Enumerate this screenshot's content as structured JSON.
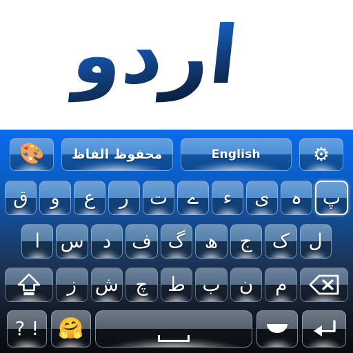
{
  "app": {
    "banner_word": "اردو",
    "background_top_color": "#ffffff",
    "accent_color": "#0a6ae8",
    "keyboard_top_color": "#0a6ae8",
    "keyboard_bottom_color": "#070a0f"
  },
  "toolbar": {
    "theme_button": {
      "label": "",
      "icon": "palette-icon",
      "glyph": "🎨"
    },
    "saved_words_button": {
      "label": "محفوظ الفاظ"
    },
    "language_button": {
      "label": "English"
    },
    "settings_button": {
      "label": "",
      "icon": "gear-icon",
      "glyph": "⚙"
    }
  },
  "keyboard": {
    "rows": [
      {
        "name": "row-1",
        "keys": [
          {
            "label": "ق",
            "name": "key-qaf"
          },
          {
            "label": "و",
            "name": "key-waw"
          },
          {
            "label": "ع",
            "name": "key-ain"
          },
          {
            "label": "ر",
            "name": "key-re"
          },
          {
            "label": "ت",
            "name": "key-te"
          },
          {
            "label": "ے",
            "name": "key-bari-ye"
          },
          {
            "label": "ء",
            "name": "key-hamza"
          },
          {
            "label": "ی",
            "name": "key-ye"
          },
          {
            "label": "ہ",
            "name": "key-gol-he"
          },
          {
            "label": "پ",
            "name": "key-pe",
            "active": true
          }
        ]
      },
      {
        "name": "row-2",
        "keys": [
          {
            "label": "ا",
            "name": "key-alif"
          },
          {
            "label": "س",
            "name": "key-seen"
          },
          {
            "label": "د",
            "name": "key-dal"
          },
          {
            "label": "ف",
            "name": "key-fe"
          },
          {
            "label": "گ",
            "name": "key-gaf"
          },
          {
            "label": "ھ",
            "name": "key-do-chashmi-he"
          },
          {
            "label": "ج",
            "name": "key-jeem"
          },
          {
            "label": "ک",
            "name": "key-kaf"
          },
          {
            "label": "ل",
            "name": "key-lam"
          }
        ]
      },
      {
        "name": "row-3",
        "keys": [
          {
            "label": "",
            "name": "shift-key",
            "icon": "shift-arrow-icon"
          },
          {
            "label": "ز",
            "name": "key-ze"
          },
          {
            "label": "ش",
            "name": "key-sheen"
          },
          {
            "label": "چ",
            "name": "key-che"
          },
          {
            "label": "ط",
            "name": "key-toe"
          },
          {
            "label": "ب",
            "name": "key-be"
          },
          {
            "label": "ن",
            "name": "key-noon"
          },
          {
            "label": "م",
            "name": "key-meem"
          },
          {
            "label": "",
            "name": "backspace-key",
            "icon": "backspace-icon"
          }
        ]
      },
      {
        "name": "row-4",
        "keys": [
          {
            "label": "! ?",
            "name": "symbols-key"
          },
          {
            "label": "",
            "name": "emoji-key",
            "icon": "hugging-face-emoji",
            "glyph": "🤗"
          },
          {
            "label": "",
            "name": "space-key",
            "icon": "space-bar-icon"
          },
          {
            "label": "",
            "name": "diacritic-key",
            "icon": "crescent-icon"
          },
          {
            "label": "",
            "name": "enter-key",
            "icon": "return-arrow-icon"
          }
        ]
      }
    ]
  }
}
